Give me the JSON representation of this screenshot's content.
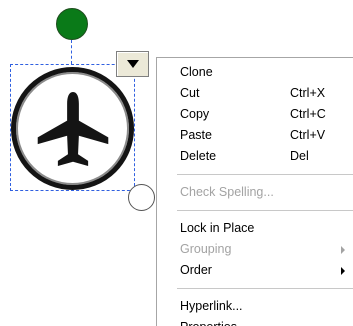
{
  "canvas": {
    "object_icon": "airplane-icon",
    "menu_trigger_icon": "triangle-down-icon",
    "accent_color": "#3060e0",
    "rotate_handle_color": "#0a7a18"
  },
  "context_menu": {
    "items": [
      {
        "label": "Clone",
        "shortcut": "",
        "enabled": true,
        "submenu": false
      },
      {
        "label": "Cut",
        "shortcut": "Ctrl+X",
        "enabled": true,
        "submenu": false
      },
      {
        "label": "Copy",
        "shortcut": "Ctrl+C",
        "enabled": true,
        "submenu": false
      },
      {
        "label": "Paste",
        "shortcut": "Ctrl+V",
        "enabled": true,
        "submenu": false
      },
      {
        "label": "Delete",
        "shortcut": "Del",
        "enabled": true,
        "submenu": false
      },
      {
        "label": "Check Spelling...",
        "shortcut": "",
        "enabled": false,
        "submenu": false
      },
      {
        "label": "Lock in Place",
        "shortcut": "",
        "enabled": true,
        "submenu": false
      },
      {
        "label": "Grouping",
        "shortcut": "",
        "enabled": false,
        "submenu": true
      },
      {
        "label": "Order",
        "shortcut": "",
        "enabled": true,
        "submenu": true
      },
      {
        "label": "Hyperlink...",
        "shortcut": "",
        "enabled": true,
        "submenu": false
      },
      {
        "label": "Properties...",
        "shortcut": "",
        "enabled": true,
        "submenu": false
      }
    ]
  }
}
